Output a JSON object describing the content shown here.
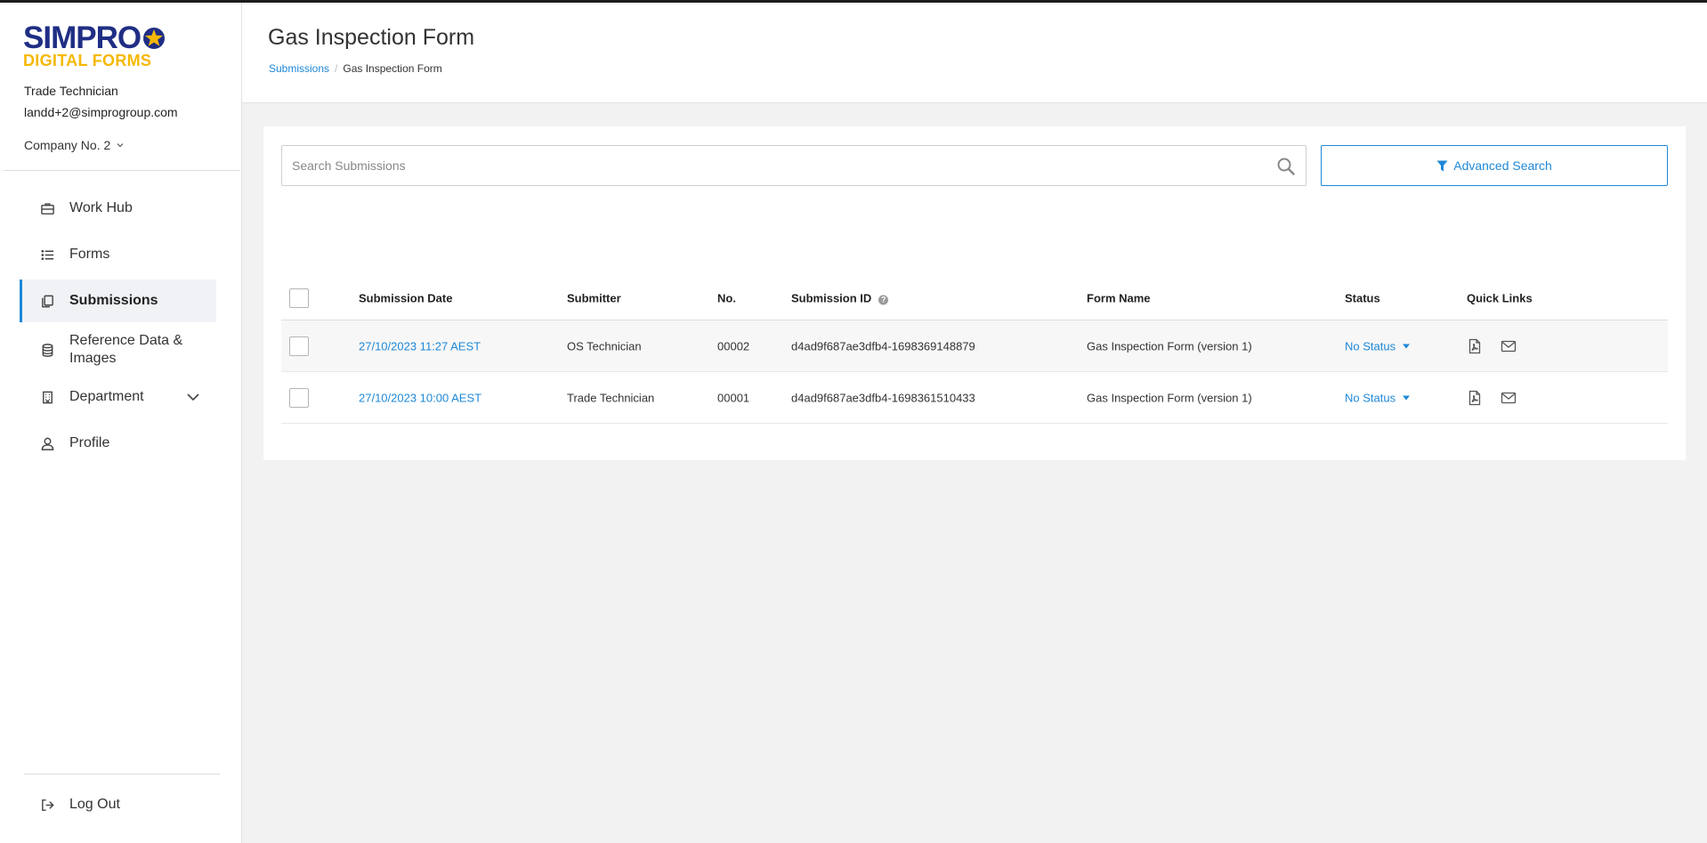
{
  "app": {
    "logo_top": "SIMPRO",
    "logo_bottom": "DIGITAL FORMS"
  },
  "user": {
    "role": "Trade Technician",
    "email": "landd+2@simprogroup.com",
    "company": "Company No. 2"
  },
  "sidebar": {
    "items": [
      {
        "label": "Work Hub",
        "icon": "briefcase-icon"
      },
      {
        "label": "Forms",
        "icon": "list-icon"
      },
      {
        "label": "Submissions",
        "icon": "copy-icon",
        "active": true
      },
      {
        "label": "Reference Data & Images",
        "icon": "database-icon"
      },
      {
        "label": "Department",
        "icon": "building-icon"
      },
      {
        "label": "Profile",
        "icon": "user-icon"
      }
    ],
    "logout_label": "Log Out"
  },
  "header": {
    "title": "Gas Inspection Form",
    "breadcrumb": {
      "root": "Submissions",
      "separator": "/",
      "current": "Gas Inspection Form"
    }
  },
  "search": {
    "placeholder": "Search Submissions",
    "advanced_label": "Advanced Search"
  },
  "table": {
    "columns": {
      "date": "Submission Date",
      "submitter": "Submitter",
      "no": "No.",
      "id": "Submission ID",
      "form": "Form Name",
      "status": "Status",
      "links": "Quick Links"
    },
    "rows": [
      {
        "date": "27/10/2023 11:27 AEST",
        "submitter": "OS Technician",
        "no": "00002",
        "id": "d4ad9f687ae3dfb4-1698369148879",
        "form": "Gas Inspection Form (version 1)",
        "status": "No Status"
      },
      {
        "date": "27/10/2023 10:00 AEST",
        "submitter": "Trade Technician",
        "no": "00001",
        "id": "d4ad9f687ae3dfb4-1698361510433",
        "form": "Gas Inspection Form (version 1)",
        "status": "No Status"
      }
    ]
  },
  "colors": {
    "accent": "#1e88d8",
    "brand_navy": "#1f2e84",
    "brand_yellow": "#f5b800"
  }
}
